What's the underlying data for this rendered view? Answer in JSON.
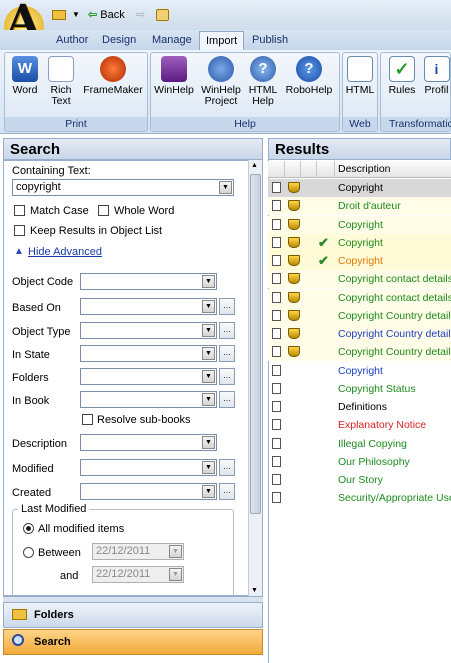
{
  "quick_access": {
    "back_label": "Back"
  },
  "tabs": [
    "Author",
    "Design",
    "Manage",
    "Import",
    "Publish"
  ],
  "active_tab": "Import",
  "ribbon": {
    "groups": [
      {
        "label": "Print",
        "buttons": [
          {
            "label1": "Word",
            "label2": "",
            "icon": "word-icon"
          },
          {
            "label1": "Rich",
            "label2": "Text",
            "icon": "rich-text-icon"
          },
          {
            "label1": "FrameMaker",
            "label2": "",
            "icon": "framemaker-icon"
          }
        ]
      },
      {
        "label": "Help",
        "buttons": [
          {
            "label1": "WinHelp",
            "label2": "",
            "icon": "winhelp-icon"
          },
          {
            "label1": "WinHelp",
            "label2": "Project",
            "icon": "winhelp-project-icon"
          },
          {
            "label1": "HTML",
            "label2": "Help",
            "icon": "html-help-icon"
          },
          {
            "label1": "RoboHelp",
            "label2": "",
            "icon": "robohelp-icon"
          }
        ]
      },
      {
        "label": "Web",
        "buttons": [
          {
            "label1": "HTML",
            "label2": "",
            "icon": "html-icon"
          }
        ]
      },
      {
        "label": "Transformatio",
        "buttons": [
          {
            "label1": "Rules",
            "label2": "",
            "icon": "rules-icon"
          },
          {
            "label1": "Profil",
            "label2": "",
            "icon": "profile-icon"
          }
        ]
      }
    ]
  },
  "search": {
    "title": "Search",
    "containing_text_label": "Containing Text:",
    "containing_text_value": "copyright",
    "match_case": "Match Case",
    "whole_word": "Whole Word",
    "keep_results": "Keep Results in Object List",
    "hide_advanced": "Hide Advanced",
    "object_code": "Object Code",
    "based_on": "Based On",
    "object_type": "Object Type",
    "in_state": "In State",
    "folders": "Folders",
    "in_book": "In Book",
    "resolve_sub_books": "Resolve sub-books",
    "description": "Description",
    "modified": "Modified",
    "created": "Created",
    "last_modified": "Last Modified",
    "all_modified_items": "All modified items",
    "between": "Between",
    "and": "and",
    "date_from": "22/12/2011",
    "date_to": "22/12/2011"
  },
  "nav": {
    "folders": "Folders",
    "search": "Search"
  },
  "results": {
    "title": "Results",
    "column_description": "Description",
    "rows": [
      {
        "text": "Copyright",
        "color": "#000000",
        "shield": true,
        "check": false,
        "selected": true
      },
      {
        "text": "Droit d'auteur",
        "color": "#1e8a1e",
        "shield": true,
        "check": false,
        "selected": false
      },
      {
        "text": "Copyright",
        "color": "#1e8a1e",
        "shield": true,
        "check": false,
        "selected": false
      },
      {
        "text": "Copyright",
        "color": "#1e8a1e",
        "shield": true,
        "check": true,
        "selected": false
      },
      {
        "text": "Copyright",
        "color": "#e07a00",
        "shield": true,
        "check": true,
        "selected": false
      },
      {
        "text": "Copyright contact details",
        "color": "#1e8a1e",
        "shield": true,
        "check": false,
        "selected": false
      },
      {
        "text": "Copyright contact details",
        "color": "#1e8a1e",
        "shield": true,
        "check": false,
        "selected": false
      },
      {
        "text": "Copyright Country details",
        "color": "#1e8a1e",
        "shield": true,
        "check": false,
        "selected": false
      },
      {
        "text": "Copyright Country details",
        "color": "#1a3fc0",
        "shield": true,
        "check": false,
        "selected": false
      },
      {
        "text": "Copyright Country details",
        "color": "#1e8a1e",
        "shield": true,
        "check": false,
        "selected": false
      },
      {
        "text": "Copyright",
        "color": "#1a3fc0",
        "shield": false,
        "check": false,
        "selected": false
      },
      {
        "text": "Copyright Status",
        "color": "#1e8a1e",
        "shield": false,
        "check": false,
        "selected": false
      },
      {
        "text": "Definitions",
        "color": "#000000",
        "shield": false,
        "check": false,
        "selected": false
      },
      {
        "text": "Explanatory Notice",
        "color": "#d81e1e",
        "shield": false,
        "check": false,
        "selected": false
      },
      {
        "text": "Illegal Copying",
        "color": "#1e8a1e",
        "shield": false,
        "check": false,
        "selected": false
      },
      {
        "text": "Our Philosophy",
        "color": "#1e8a1e",
        "shield": false,
        "check": false,
        "selected": false
      },
      {
        "text": "Our Story",
        "color": "#1e8a1e",
        "shield": false,
        "check": false,
        "selected": false
      },
      {
        "text": "Security/Appropriate Use",
        "color": "#1e8a1e",
        "shield": false,
        "check": false,
        "selected": false
      }
    ]
  }
}
